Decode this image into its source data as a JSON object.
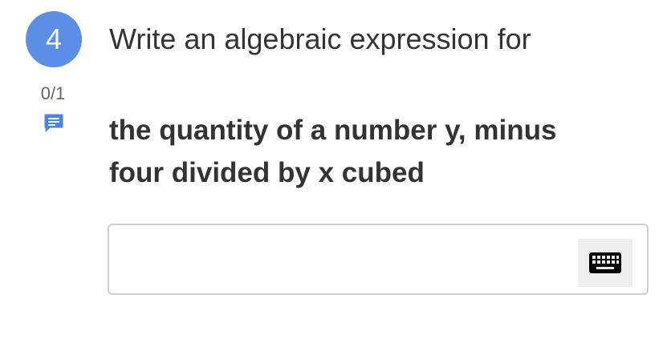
{
  "question": {
    "number": "4",
    "score": "0/1",
    "prompt": "Write an algebraic expression for",
    "expression_line1": "the quantity of a number y, minus",
    "expression_line2": "four divided by x cubed"
  },
  "answer": {
    "value": "",
    "placeholder": ""
  },
  "icons": {
    "comment": "comment-icon",
    "keyboard": "keyboard-icon"
  },
  "colors": {
    "badge": "#5b8fe6",
    "comment_icon": "#4a86e8",
    "keyboard_icon": "#000000",
    "input_border": "#cfcfcf"
  }
}
